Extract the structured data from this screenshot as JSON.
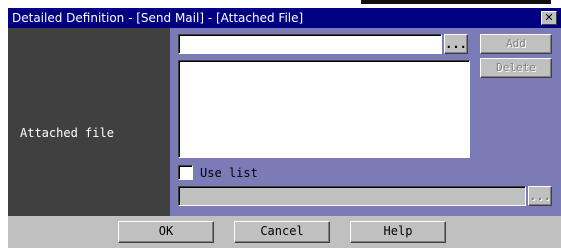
{
  "window": {
    "title": "Detailed Definition - [Send Mail] - [Attached File]",
    "close_glyph": "✕"
  },
  "attached": {
    "label": "Attached file",
    "browse_label": "...",
    "add_label": "Add",
    "delete_label": "Delete",
    "use_list_label": "Use list",
    "list_browse_label": "...",
    "file_value": "",
    "list_value": ""
  },
  "footer": {
    "ok_label": "OK",
    "cancel_label": "Cancel",
    "help_label": "Help"
  },
  "colors": {
    "titlebar": "#000080",
    "left_panel": "#404040",
    "right_panel": "#7b7bb8",
    "dialog": "#c0c0c0"
  }
}
